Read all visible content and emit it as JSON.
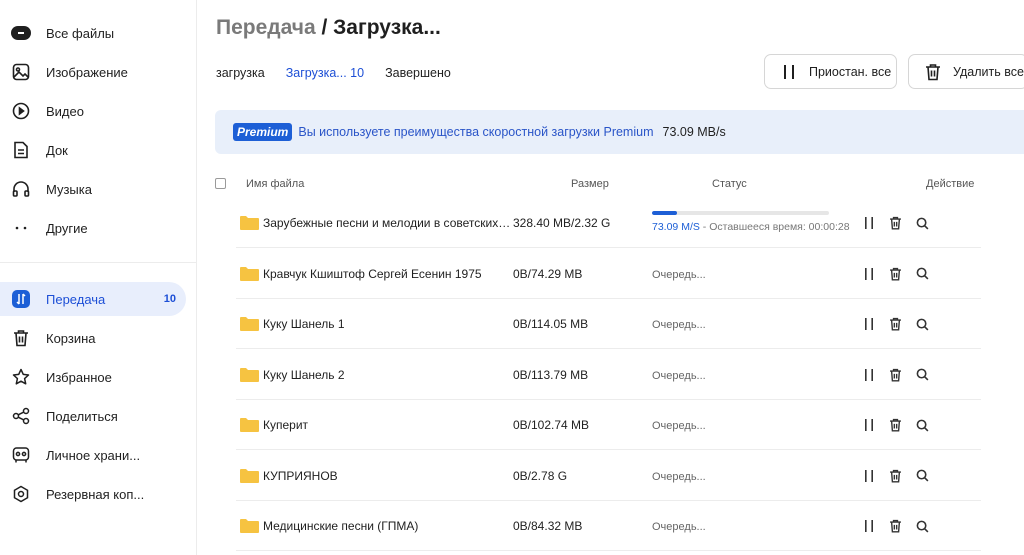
{
  "sidebar": {
    "items": [
      {
        "label": "Все файлы",
        "icon": "all-files-icon"
      },
      {
        "label": "Изображение",
        "icon": "image-icon"
      },
      {
        "label": "Видео",
        "icon": "video-icon"
      },
      {
        "label": "Док",
        "icon": "document-icon"
      },
      {
        "label": "Музыка",
        "icon": "headphones-icon"
      },
      {
        "label": "Другие",
        "icon": "more-dots-icon"
      },
      {
        "label": "Передача",
        "icon": "transfer-icon",
        "count": "10",
        "active": true
      },
      {
        "label": "Корзина",
        "icon": "trash-icon"
      },
      {
        "label": "Избранное",
        "icon": "star-icon"
      },
      {
        "label": "Поделиться",
        "icon": "share-icon"
      },
      {
        "label": "Личное храни...",
        "icon": "private-vault-icon"
      },
      {
        "label": "Резервная коп...",
        "icon": "backup-icon"
      }
    ]
  },
  "header": {
    "title_part1": "Передача",
    "title_sep": " / ",
    "title_part2": "Загрузка..."
  },
  "tabs": [
    {
      "label": "загрузка",
      "active": false
    },
    {
      "label": "Загрузка... 10",
      "active": true
    },
    {
      "label": "Завершено",
      "active": false
    }
  ],
  "actions": {
    "pause_all": "Приостан. все",
    "delete_all": "Удалить все"
  },
  "banner": {
    "badge": "Premium",
    "text": "Вы используете преимущества скоростной загрузки Premium",
    "speed": "73.09 MB/s"
  },
  "table": {
    "columns": {
      "name": "Имя файла",
      "size": "Размер",
      "status": "Статус",
      "action": "Действие"
    },
    "rows": [
      {
        "name": "Зарубежные песни и мелодии в советских фильмах",
        "size": "328.40 MB/2.32 G",
        "progress": 0.14,
        "speed": "73.09 M/S",
        "remaining": " - Оставшееся время: 00:00:28"
      },
      {
        "name": "Кравчук Кшиштоф Сергей Есенин 1975",
        "size": "0B/74.29 MB",
        "status": "Очередь..."
      },
      {
        "name": "Куку Шанель 1",
        "size": "0B/114.05 MB",
        "status": "Очередь..."
      },
      {
        "name": "Куку Шанель 2",
        "size": "0B/113.79 MB",
        "status": "Очередь..."
      },
      {
        "name": "Куперит",
        "size": "0B/102.74 MB",
        "status": "Очередь..."
      },
      {
        "name": "КУПРИЯНОВ",
        "size": "0B/2.78 G",
        "status": "Очередь..."
      },
      {
        "name": "Медицинские песни (ГПМА)",
        "size": "0B/84.32 MB",
        "status": "Очередь..."
      }
    ]
  },
  "colors": {
    "accent": "#1d5fd6",
    "active_bg": "#e8eefc",
    "banner_bg": "#e8effa",
    "folder": "#f6c341"
  }
}
